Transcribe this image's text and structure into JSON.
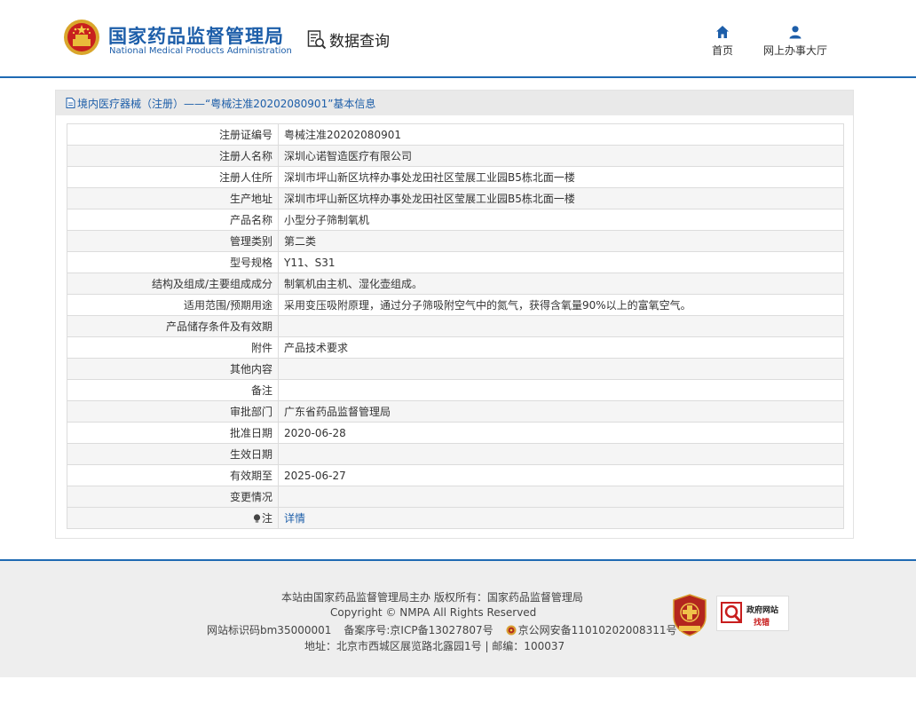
{
  "header": {
    "brand_cn": "国家药品监督管理局",
    "brand_en": "National Medical Products Administration",
    "data_query": "数据查询",
    "nav": [
      {
        "label": "首页",
        "icon": "home-icon"
      },
      {
        "label": "网上办事大厅",
        "icon": "user-icon"
      }
    ]
  },
  "breadcrumb": {
    "text": "境内医疗器械（注册）——“粤械注准20202080901”基本信息",
    "icon": "document-icon"
  },
  "record": {
    "rows": [
      {
        "label": "注册证编号",
        "value": "粤械注准20202080901"
      },
      {
        "label": "注册人名称",
        "value": "深圳心诺智造医疗有限公司"
      },
      {
        "label": "注册人住所",
        "value": "深圳市坪山新区坑梓办事处龙田社区莹展工业园B5栋北面一楼"
      },
      {
        "label": "生产地址",
        "value": "深圳市坪山新区坑梓办事处龙田社区莹展工业园B5栋北面一楼"
      },
      {
        "label": "产品名称",
        "value": "小型分子筛制氧机"
      },
      {
        "label": "管理类别",
        "value": "第二类"
      },
      {
        "label": "型号规格",
        "value": "Y11、S31"
      },
      {
        "label": "结构及组成/主要组成成分",
        "value": "制氧机由主机、湿化壶组成。"
      },
      {
        "label": "适用范围/预期用途",
        "value": "采用变压吸附原理，通过分子筛吸附空气中的氮气，获得含氧量90%以上的富氧空气。"
      },
      {
        "label": "产品储存条件及有效期",
        "value": ""
      },
      {
        "label": "附件",
        "value": "产品技术要求"
      },
      {
        "label": "其他内容",
        "value": ""
      },
      {
        "label": "备注",
        "value": ""
      },
      {
        "label": "审批部门",
        "value": "广东省药品监督管理局"
      },
      {
        "label": "批准日期",
        "value": "2020-06-28"
      },
      {
        "label": "生效日期",
        "value": ""
      },
      {
        "label": "有效期至",
        "value": "2025-06-27"
      },
      {
        "label": "变更情况",
        "value": ""
      }
    ],
    "note_label": "注",
    "note_link": "详情"
  },
  "footer": {
    "line1": "本站由国家药品监督管理局主办 版权所有：国家药品监督管理局",
    "line2": "Copyright © NMPA All Rights Reserved",
    "site_id": "网站标识码bm35000001",
    "icp": "备案序号:京ICP备13027807号",
    "police": "京公网安备11010202008311号",
    "line4": "地址：北京市西城区展览路北露园1号 | 邮编：100037",
    "badge_gov_error_top": "政府网站",
    "badge_gov_error_bottom": "找错",
    "colors": {
      "accent": "#1f6ab3",
      "link": "#1d5ea9",
      "badge_red": "#b3261e"
    }
  }
}
